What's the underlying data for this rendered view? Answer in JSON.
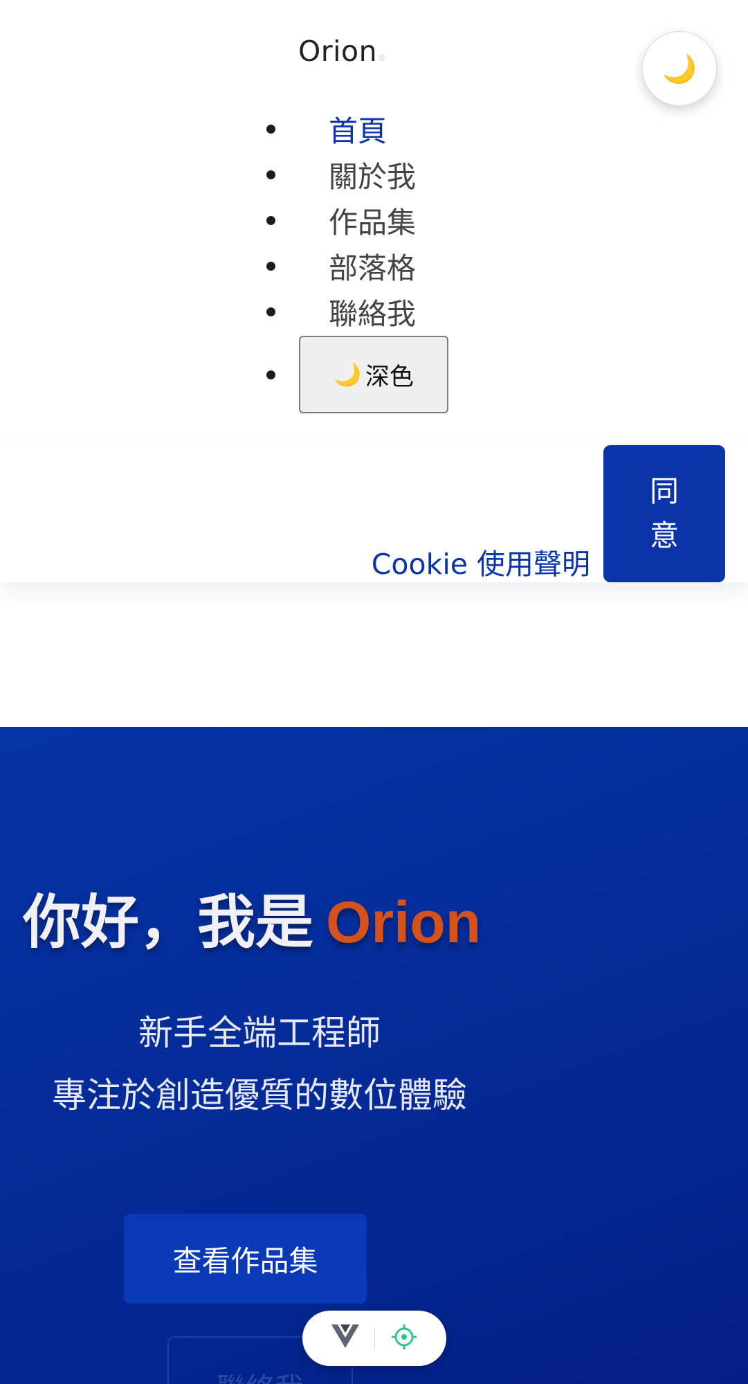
{
  "header": {
    "brand": "Orion",
    "theme_float_icon": "moon-icon",
    "nav": [
      {
        "label": "首頁",
        "active": true
      },
      {
        "label": "關於我",
        "active": false
      },
      {
        "label": "作品集",
        "active": false
      },
      {
        "label": "部落格",
        "active": false
      },
      {
        "label": "聯絡我",
        "active": false
      }
    ],
    "dark_toggle": {
      "icon": "moon-icon",
      "label": "深色"
    }
  },
  "cookie": {
    "link_text": "Cookie 使用聲明",
    "agree_label": "同意"
  },
  "hero": {
    "greeting": "你好，我是",
    "name": "Orion",
    "subtitle_line1": "新手全端工程師",
    "subtitle_line2": "專注於創造優質的數位體驗",
    "primary_button": "查看作品集",
    "secondary_button": "聯絡我"
  },
  "devtools": {
    "left_icon": "vue-logo-icon",
    "right_icon": "target-icon"
  },
  "colors": {
    "accent": "#0a34a8",
    "hero_bg": "#042c98",
    "name_highlight": "#d5521d"
  }
}
